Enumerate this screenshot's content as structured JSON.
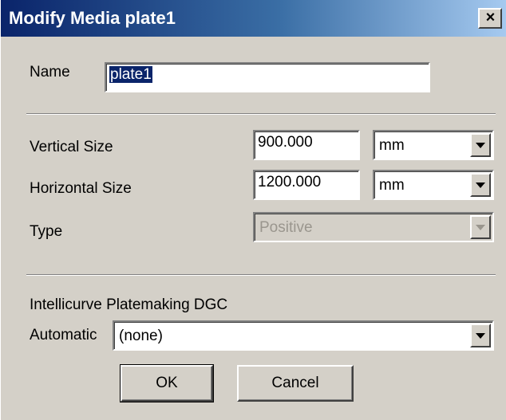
{
  "window": {
    "title": "Modify Media plate1",
    "close_symbol": "×",
    "close_icon": "close-icon"
  },
  "name_field": {
    "label": "Name",
    "value": "plate1"
  },
  "vertical_size": {
    "label": "Vertical Size",
    "value": "900.000",
    "unit": "mm"
  },
  "horizontal_size": {
    "label": "Horizontal Size",
    "value": "1200.000",
    "unit": "mm"
  },
  "type": {
    "label": "Type",
    "value": "Positive",
    "enabled": false
  },
  "dgc": {
    "section_label": "Intellicurve Platemaking DGC",
    "automatic_label": "Automatic",
    "automatic_value": "(none)"
  },
  "buttons": {
    "ok": "OK",
    "cancel": "Cancel"
  },
  "colors": {
    "title_start": "#0a246a",
    "title_end": "#a6caf0",
    "face": "#d4d0c8",
    "selection": "#0a246a"
  }
}
